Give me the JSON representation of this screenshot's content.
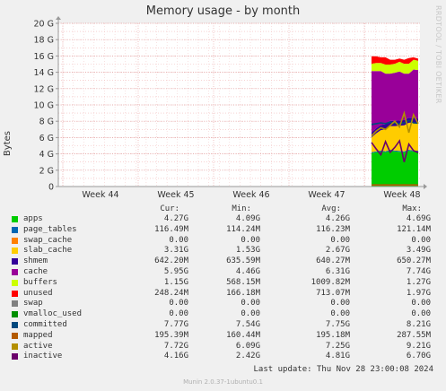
{
  "title": "Memory usage - by month",
  "side_text": "RRDTOOL / TOBI OETIKER",
  "footer": "Munin 2.0.37-1ubuntu0.1",
  "last_update": "Last update: Thu Nov 28 23:00:08 2024",
  "legend_headers": [
    "Cur:",
    "Min:",
    "Avg:",
    "Max:"
  ],
  "legend": [
    {
      "name": "apps",
      "color": "#00cc00",
      "cur": "4.27G",
      "min": "4.09G",
      "avg": "4.26G",
      "max": "4.69G"
    },
    {
      "name": "page_tables",
      "color": "#0066b3",
      "cur": "116.49M",
      "min": "114.24M",
      "avg": "116.23M",
      "max": "121.14M"
    },
    {
      "name": "swap_cache",
      "color": "#ff8000",
      "cur": "0.00",
      "min": "0.00",
      "avg": "0.00",
      "max": "0.00"
    },
    {
      "name": "slab_cache",
      "color": "#ffcc00",
      "cur": "3.31G",
      "min": "1.53G",
      "avg": "2.67G",
      "max": "3.49G"
    },
    {
      "name": "shmem",
      "color": "#330099",
      "cur": "642.20M",
      "min": "635.59M",
      "avg": "640.27M",
      "max": "650.27M"
    },
    {
      "name": "cache",
      "color": "#990099",
      "cur": "5.95G",
      "min": "4.46G",
      "avg": "6.31G",
      "max": "7.74G"
    },
    {
      "name": "buffers",
      "color": "#ccff00",
      "cur": "1.15G",
      "min": "568.15M",
      "avg": "1009.82M",
      "max": "1.27G"
    },
    {
      "name": "unused",
      "color": "#ff0000",
      "cur": "248.24M",
      "min": "166.18M",
      "avg": "713.07M",
      "max": "1.97G"
    },
    {
      "name": "swap",
      "color": "#808080",
      "cur": "0.00",
      "min": "0.00",
      "avg": "0.00",
      "max": "0.00"
    },
    {
      "name": "vmalloc_used",
      "color": "#008f00",
      "cur": "0.00",
      "min": "0.00",
      "avg": "0.00",
      "max": "0.00"
    },
    {
      "name": "committed",
      "color": "#00487d",
      "cur": "7.77G",
      "min": "7.54G",
      "avg": "7.75G",
      "max": "8.21G"
    },
    {
      "name": "mapped",
      "color": "#b35a00",
      "cur": "195.39M",
      "min": "160.44M",
      "avg": "195.18M",
      "max": "287.55M"
    },
    {
      "name": "active",
      "color": "#b38f00",
      "cur": "7.72G",
      "min": "6.09G",
      "avg": "7.25G",
      "max": "9.21G"
    },
    {
      "name": "inactive",
      "color": "#6b006b",
      "cur": "4.16G",
      "min": "2.42G",
      "avg": "4.81G",
      "max": "6.70G"
    }
  ],
  "chart_data": {
    "type": "area",
    "title": "Memory usage - by month",
    "ylabel": "Bytes",
    "xlabel": "",
    "y_ticks": [
      "0",
      "2 G",
      "4 G",
      "6 G",
      "8 G",
      "10 G",
      "12 G",
      "14 G",
      "16 G",
      "18 G",
      "20 G"
    ],
    "ylim": [
      0,
      20
    ],
    "y_unit": "GiB",
    "x_ticks": [
      "Week 44",
      "Week 45",
      "Week 46",
      "Week 47",
      "Week 48"
    ],
    "grid": true,
    "data_window": "last part of Week 48 (approx. Nov 25 - Nov 28)",
    "stacked_series": [
      {
        "name": "apps",
        "color": "#00cc00",
        "values": [
          4.1,
          4.2,
          4.3,
          4.2,
          4.4,
          4.3,
          4.25,
          4.2,
          4.4,
          4.3,
          4.27
        ]
      },
      {
        "name": "page_tables",
        "color": "#0066b3",
        "values": [
          0.11,
          0.11,
          0.11,
          0.11,
          0.11,
          0.11,
          0.11,
          0.11,
          0.11,
          0.11,
          0.11
        ]
      },
      {
        "name": "swap_cache",
        "color": "#ff8000",
        "values": [
          0,
          0,
          0,
          0,
          0,
          0,
          0,
          0,
          0,
          0,
          0
        ]
      },
      {
        "name": "slab_cache",
        "color": "#ffcc00",
        "values": [
          1.8,
          2.2,
          2.5,
          2.7,
          2.9,
          3.0,
          3.1,
          3.2,
          3.3,
          3.4,
          3.31
        ]
      },
      {
        "name": "shmem",
        "color": "#330099",
        "values": [
          0.63,
          0.63,
          0.63,
          0.63,
          0.63,
          0.63,
          0.63,
          0.63,
          0.63,
          0.63,
          0.63
        ]
      },
      {
        "name": "cache",
        "color": "#990099",
        "values": [
          7.5,
          7.0,
          6.6,
          6.2,
          5.8,
          5.9,
          6.0,
          5.7,
          5.4,
          5.9,
          5.95
        ]
      },
      {
        "name": "buffers",
        "color": "#ccff00",
        "values": [
          0.9,
          1.0,
          1.0,
          1.1,
          1.1,
          1.1,
          1.2,
          1.2,
          1.2,
          1.2,
          1.15
        ]
      },
      {
        "name": "unused",
        "color": "#ff0000",
        "values": [
          0.9,
          0.8,
          0.7,
          0.9,
          0.6,
          0.5,
          0.4,
          0.5,
          0.7,
          0.3,
          0.25
        ]
      }
    ],
    "line_series": [
      {
        "name": "committed",
        "color": "#00487d",
        "values": [
          7.6,
          7.7,
          7.8,
          7.7,
          7.9,
          7.75,
          7.7,
          7.8,
          8.1,
          7.8,
          7.77
        ]
      },
      {
        "name": "mapped",
        "color": "#b35a00",
        "values": [
          0.19,
          0.2,
          0.19,
          0.2,
          0.19,
          0.2,
          0.19,
          0.2,
          0.19,
          0.2,
          0.19
        ]
      },
      {
        "name": "active",
        "color": "#b38f00",
        "values": [
          6.2,
          6.8,
          7.2,
          7.0,
          7.5,
          8.0,
          7.3,
          9.0,
          6.6,
          8.8,
          7.72
        ]
      },
      {
        "name": "inactive",
        "color": "#6b006b",
        "values": [
          5.4,
          4.6,
          3.9,
          5.5,
          4.2,
          4.8,
          5.6,
          3.0,
          5.2,
          4.4,
          4.16
        ]
      }
    ]
  }
}
